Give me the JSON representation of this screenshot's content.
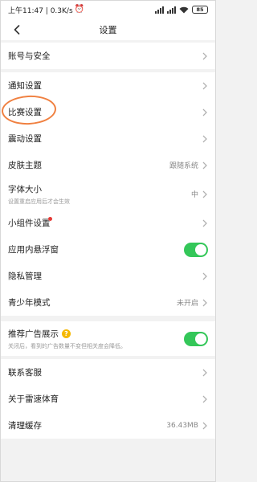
{
  "status_bar": {
    "left_text": "上午11:47 | 0.3K/s",
    "battery": "85"
  },
  "header": {
    "title": "设置"
  },
  "sections": [
    {
      "rows": [
        {
          "label": "账号与安全"
        }
      ]
    },
    {
      "rows": [
        {
          "label": "通知设置"
        },
        {
          "label": "比赛设置"
        },
        {
          "label": "震动设置"
        },
        {
          "label": "皮肤主题",
          "value": "跟随系统"
        },
        {
          "label": "字体大小",
          "sub": "设置重启应用后才会生效",
          "value": "中"
        },
        {
          "label": "小组件设置"
        },
        {
          "label": "应用内悬浮窗",
          "toggle": true
        },
        {
          "label": "隐私管理"
        },
        {
          "label": "青少年模式",
          "value": "未开启"
        }
      ]
    },
    {
      "rows": [
        {
          "label": "推荐广告展示",
          "sub": "关闭后，看到的广告数量不变但相关度会降低。",
          "toggle": true
        }
      ]
    },
    {
      "rows": [
        {
          "label": "联系客服"
        },
        {
          "label": "关于雷速体育"
        },
        {
          "label": "清理缓存",
          "value": "36.43MB"
        }
      ]
    }
  ],
  "colors": {
    "toggle_on": "#34c759",
    "highlight_ring": "#f08040",
    "help_icon": "#f5b800",
    "red_dot": "#e53935"
  }
}
